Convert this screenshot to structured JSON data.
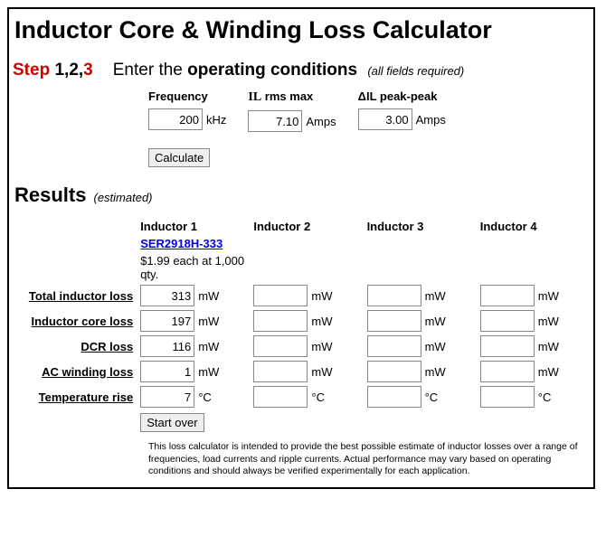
{
  "title": "Inductor Core & Winding Loss Calculator",
  "step": {
    "word": "Step",
    "nums": "1,2,",
    "current": "3",
    "prompt_pre": "Enter the ",
    "prompt_bold": "operating conditions",
    "prompt_req": "(all fields required)"
  },
  "inputs": {
    "freq_label": "Frequency",
    "freq_value": "200",
    "freq_unit": "kHz",
    "il_label_serif": "IL",
    "il_label_rest": " rms max",
    "il_value": "7.10",
    "il_unit": "Amps",
    "dil_label": "ΔIL peak-peak",
    "dil_value": "3.00",
    "dil_unit": "Amps",
    "calc_btn": "Calculate"
  },
  "results": {
    "heading": "Results",
    "sub": "(estimated)",
    "col1": "Inductor 1",
    "col2": "Inductor 2",
    "col3": "Inductor 3",
    "col4": "Inductor 4",
    "part": "SER2918H-333",
    "price": "$1.99 each at 1,000 qty.",
    "rows": {
      "total": "Total inductor loss",
      "core": "Inductor core loss",
      "dcr": "DCR loss",
      "ac": "AC winding loss",
      "temp": "Temperature rise"
    },
    "vals": {
      "total": "313",
      "core": "197",
      "dcr": "116",
      "ac": "1",
      "temp": "7"
    },
    "unit_mw": "mW",
    "unit_c": "°C",
    "start_over": "Start over"
  },
  "footnote": "This loss calculator is intended to provide the best possible estimate of inductor losses over a range of frequencies, load currents and ripple currents. Actual performance may vary based on operating conditions and should always be verified experimentally for each application."
}
